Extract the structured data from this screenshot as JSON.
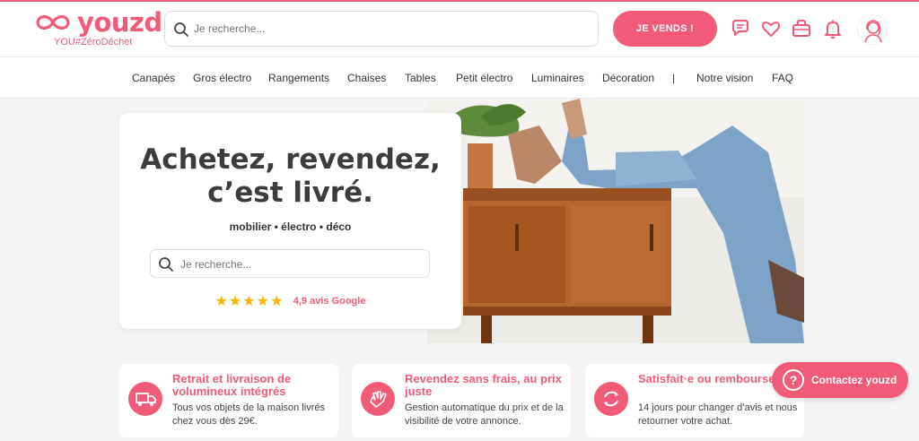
{
  "header": {
    "logo_text": "youzd",
    "logo_tagline": "YOU#ZéroDéchet",
    "search_placeholder": "Je recherche...",
    "sell_button": "JE VENDS !",
    "icons": [
      "chat-icon",
      "heart-icon",
      "basket-icon",
      "bell-icon",
      "user-avatar-icon"
    ]
  },
  "nav": {
    "items": [
      "Canapés",
      "Gros électro",
      "Rangements",
      "Chaises",
      "Tables",
      "Petit électro",
      "Luminaires",
      "Décoration",
      "|",
      "Notre vision",
      "FAQ"
    ]
  },
  "hero": {
    "title_line1": "Achetez, revendez,",
    "title_line2": "c’est livré.",
    "subtitle": "mobilier • électro • déco",
    "search_placeholder": "Je recherche...",
    "stars": "★★★★★",
    "rating_text": "4,9 avis Google"
  },
  "features": [
    {
      "title": "Retrait et livraison de volumineux intégrés",
      "desc": "Tous vos objets de la maison livrés chez vous dès 29€.",
      "icon": "truck-icon"
    },
    {
      "title": "Revendez sans frais, au prix juste",
      "desc": "Gestion automatique du prix et de la visibilité de votre annonce.",
      "icon": "hand-icon"
    },
    {
      "title": "Satisfait·e ou rembourse",
      "desc": "14 jours pour changer d’avis et nous retourner votre achat.",
      "icon": "refresh-icon"
    }
  ],
  "contact_button": "Contactez youzd",
  "colors": {
    "accent": "#f25b77",
    "star": "#f7b500",
    "background": "#f4f4f4"
  }
}
